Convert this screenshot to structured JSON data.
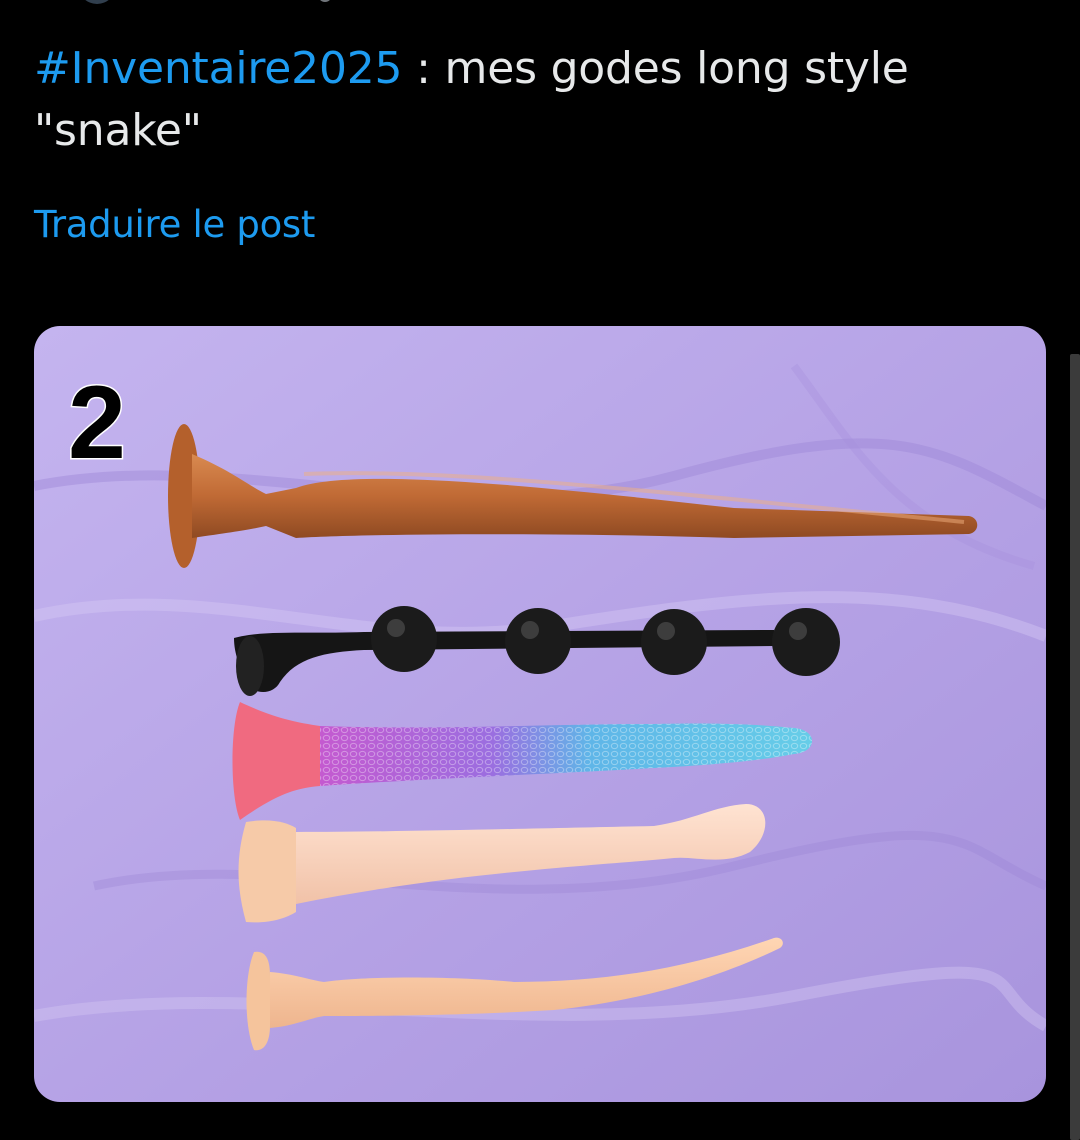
{
  "post": {
    "hashtag": "#Inventaire2025",
    "text": " : mes godes long style \"snake\"",
    "translate_label": "Traduire le post"
  },
  "media": {
    "overlay_number": "2"
  },
  "colors": {
    "background": "#000000",
    "text": "#e7e9ea",
    "link": "#1d9bf0",
    "sheet": "#b8a6e6"
  }
}
